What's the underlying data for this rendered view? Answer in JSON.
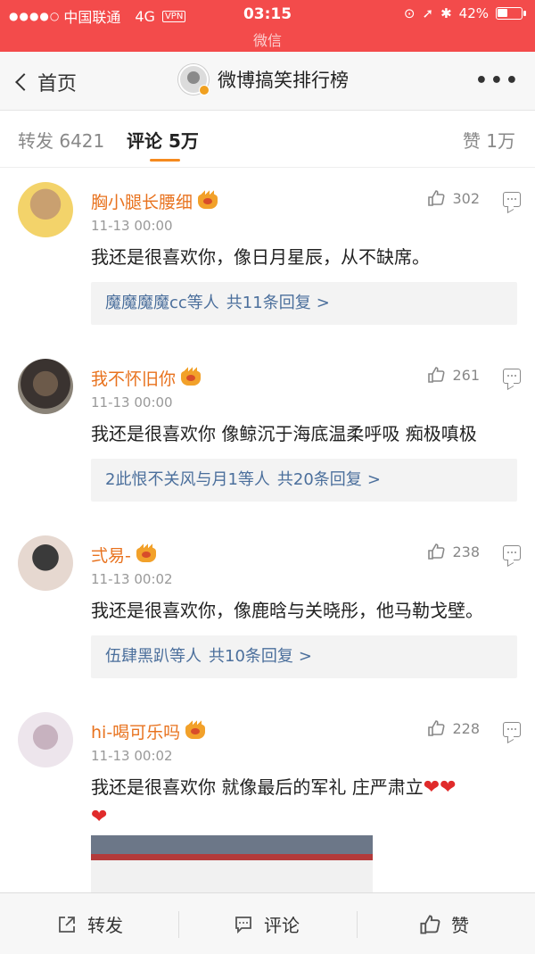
{
  "status_bar": {
    "carrier": "中国联通",
    "network": "4G",
    "vpn": "VPN",
    "time": "03:15",
    "battery": "42%",
    "battery_level": 0.42,
    "app_name": "微信"
  },
  "nav": {
    "back_label": "首页",
    "title": "微博搞笑排行榜",
    "more": "•••"
  },
  "tabs": {
    "repost": "转发 6421",
    "comment": "评论 5万",
    "like": "赞 1万"
  },
  "comments": [
    {
      "user": "胸小腿长腰细",
      "time": "11-13 00:00",
      "text": "我还是很喜欢你，像日月星辰，从不缺席。",
      "likes": "302",
      "reply_users": "魔魔魔魔cc等人",
      "reply_count": "共11条回复",
      "reply_arrow": ">"
    },
    {
      "user": "我不怀旧你",
      "time": "11-13 00:00",
      "text": "我还是很喜欢你 像鲸沉于海底温柔呼吸  痴极嗔极",
      "likes": "261",
      "reply_users": "2此恨不关风与月1等人",
      "reply_count": "共20条回复",
      "reply_arrow": ">"
    },
    {
      "user": "弍易-",
      "time": "11-13 00:02",
      "text": "我还是很喜欢你，像鹿晗与关晓彤，他马勒戈壁。",
      "likes": "238",
      "reply_users": "伍肆黑趴等人",
      "reply_count": "共10条回复",
      "reply_arrow": ">"
    },
    {
      "user": "hi-喝可乐吗",
      "time": "11-13 00:02",
      "text": "我还是很喜欢你 就像最后的军礼 庄严肃立",
      "likes": "228"
    }
  ],
  "toolbar": {
    "repost": "转发",
    "comment": "评论",
    "like": "赞"
  },
  "colors": {
    "status_bar": "#f34b4b",
    "username": "#e8721e",
    "reply_link": "#4b6f9c",
    "tab_indicator": "#f58a1f",
    "heart": "#e02b2b"
  }
}
